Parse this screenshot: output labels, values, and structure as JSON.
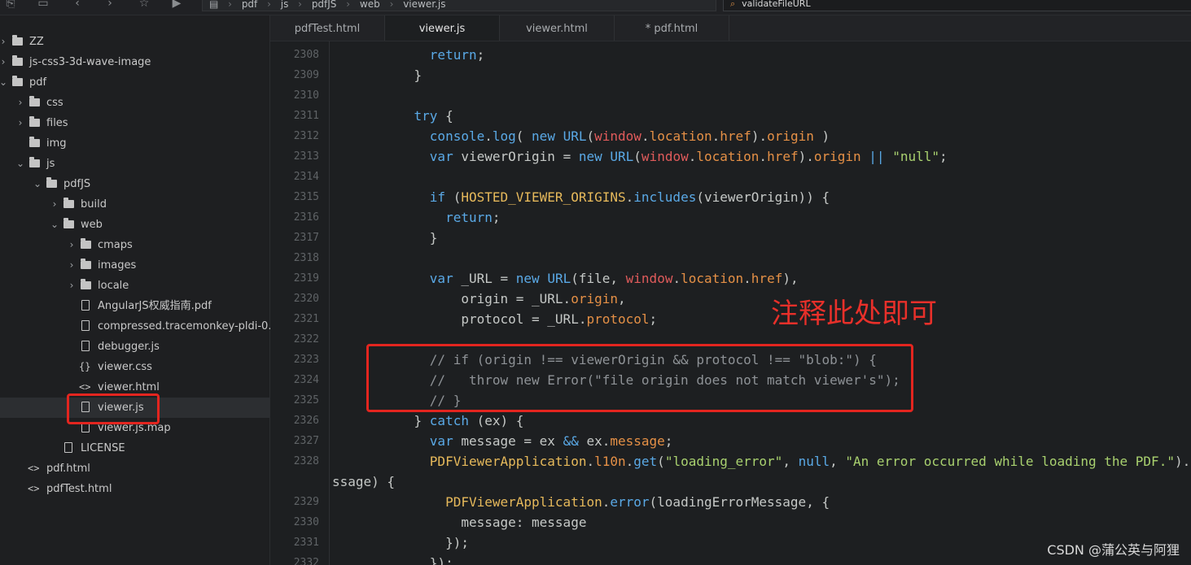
{
  "toolbar": {
    "breadcrumb": [
      "pdf",
      "js",
      "pdfJS",
      "web",
      "viewer.js"
    ],
    "search_value": "validateFileURL"
  },
  "sidebar": {
    "items": [
      {
        "label": "ZZ",
        "type": "folder",
        "depth": 0,
        "expanded": false
      },
      {
        "label": "js-css3-3d-wave-image",
        "type": "folder",
        "depth": 0,
        "expanded": false
      },
      {
        "label": "pdf",
        "type": "folder",
        "depth": 0,
        "expanded": true
      },
      {
        "label": "css",
        "type": "folder",
        "depth": 1,
        "expanded": false
      },
      {
        "label": "files",
        "type": "folder",
        "depth": 1,
        "expanded": false
      },
      {
        "label": "img",
        "type": "folder",
        "depth": 1,
        "expanded": null
      },
      {
        "label": "js",
        "type": "folder",
        "depth": 1,
        "expanded": true
      },
      {
        "label": "pdfJS",
        "type": "folder",
        "depth": 2,
        "expanded": true
      },
      {
        "label": "build",
        "type": "folder",
        "depth": 3,
        "expanded": false
      },
      {
        "label": "web",
        "type": "folder",
        "depth": 3,
        "expanded": true
      },
      {
        "label": "cmaps",
        "type": "folder",
        "depth": 4,
        "expanded": false
      },
      {
        "label": "images",
        "type": "folder",
        "depth": 4,
        "expanded": false
      },
      {
        "label": "locale",
        "type": "folder",
        "depth": 4,
        "expanded": false
      },
      {
        "label": "AngularJS权威指南.pdf",
        "type": "file",
        "depth": 4
      },
      {
        "label": "compressed.tracemonkey-pldi-0...",
        "type": "file",
        "depth": 4
      },
      {
        "label": "debugger.js",
        "type": "file",
        "depth": 4
      },
      {
        "label": "viewer.css",
        "type": "css",
        "depth": 4
      },
      {
        "label": "viewer.html",
        "type": "html",
        "depth": 4
      },
      {
        "label": "viewer.js",
        "type": "file",
        "depth": 4,
        "selected": true
      },
      {
        "label": "viewer.js.map",
        "type": "file",
        "depth": 4
      },
      {
        "label": "LICENSE",
        "type": "file",
        "depth": 3
      },
      {
        "label": "pdf.html",
        "type": "html",
        "depth": 1
      },
      {
        "label": "pdfTest.html",
        "type": "html",
        "depth": 1
      }
    ]
  },
  "tabs": [
    {
      "label": "pdfTest.html",
      "active": false
    },
    {
      "label": "viewer.js",
      "active": true
    },
    {
      "label": "viewer.html",
      "active": false
    },
    {
      "label": "* pdf.html",
      "active": false
    }
  ],
  "editor": {
    "lines": [
      {
        "num": "2308",
        "html": "      <span class='kw'>return</span>;"
      },
      {
        "num": "2309",
        "html": "    }"
      },
      {
        "num": "2310",
        "html": ""
      },
      {
        "num": "2311",
        "html": "    <span class='kw'>try</span> {"
      },
      {
        "num": "2312",
        "html": "      <span class='fn'>console</span>.<span class='fn'>log</span>( <span class='kw'>new</span> <span class='fn'>URL</span>(<span class='obj'>window</span>.<span class='prop'>location</span>.<span class='prop'>href</span>).<span class='prop'>origin</span> )"
      },
      {
        "num": "2313",
        "html": "      <span class='kw'>var</span> viewerOrigin = <span class='kw'>new</span> <span class='fn'>URL</span>(<span class='obj'>window</span>.<span class='prop'>location</span>.<span class='prop'>href</span>).<span class='prop'>origin</span> <span class='kw'>||</span> <span class='str'>\"null\"</span>;"
      },
      {
        "num": "2314",
        "html": ""
      },
      {
        "num": "2315",
        "html": "      <span class='kw'>if</span> (<span class='cls'>HOSTED_VIEWER_ORIGINS</span>.<span class='fn'>includes</span>(viewerOrigin)) {"
      },
      {
        "num": "2316",
        "html": "        <span class='kw'>return</span>;"
      },
      {
        "num": "2317",
        "html": "      }"
      },
      {
        "num": "2318",
        "html": ""
      },
      {
        "num": "2319",
        "html": "      <span class='kw'>var</span> _URL = <span class='kw'>new</span> <span class='fn'>URL</span>(file, <span class='obj'>window</span>.<span class='prop'>location</span>.<span class='prop'>href</span>),"
      },
      {
        "num": "2320",
        "html": "          origin = _URL.<span class='prop'>origin</span>,"
      },
      {
        "num": "2321",
        "html": "          protocol = _URL.<span class='prop'>protocol</span>;"
      },
      {
        "num": "2322",
        "html": ""
      },
      {
        "num": "2323",
        "html": "      <span class='cmt'>// if (origin !== viewerOrigin &amp;&amp; protocol !== \"blob:\") {</span>"
      },
      {
        "num": "2324",
        "html": "      <span class='cmt'>//   throw new Error(\"file origin does not match viewer's\");</span>"
      },
      {
        "num": "2325",
        "html": "      <span class='cmt'>// }</span>"
      },
      {
        "num": "2326",
        "html": "    } <span class='kw'>catch</span> (ex) {"
      },
      {
        "num": "2327",
        "html": "      <span class='kw'>var</span> message = ex <span class='kw'>&amp;&amp;</span> ex.<span class='prop'>message</span>;"
      },
      {
        "num": "2328",
        "html": "      <span class='cls'>PDFViewerApplication</span>.<span class='prop'>l10n</span>.<span class='fn'>get</span>(<span class='str'>\"loading_error\"</span>, <span class='kw'>null</span>, <span class='str'>\"An error occurred while loading the PDF.\"</span>).<span class='fn'>then</span>"
      },
      {
        "num": "",
        "html": "<span style='margin-left:-62px'>ssage) {</span>"
      },
      {
        "num": "2329",
        "html": "        <span class='cls'>PDFViewerApplication</span>.<span class='fn'>error</span>(loadingErrorMessage, {"
      },
      {
        "num": "2330",
        "html": "          message: message"
      },
      {
        "num": "2331",
        "html": "        });"
      },
      {
        "num": "2332",
        "html": "      });"
      }
    ]
  },
  "annotation": {
    "text": "注释此处即可"
  },
  "watermark": "CSDN @蒲公英与阿狸",
  "colors": {
    "annotation_red": "#e3251f",
    "keyword_blue": "#5aa9e6",
    "string_green": "#a9d16f"
  }
}
